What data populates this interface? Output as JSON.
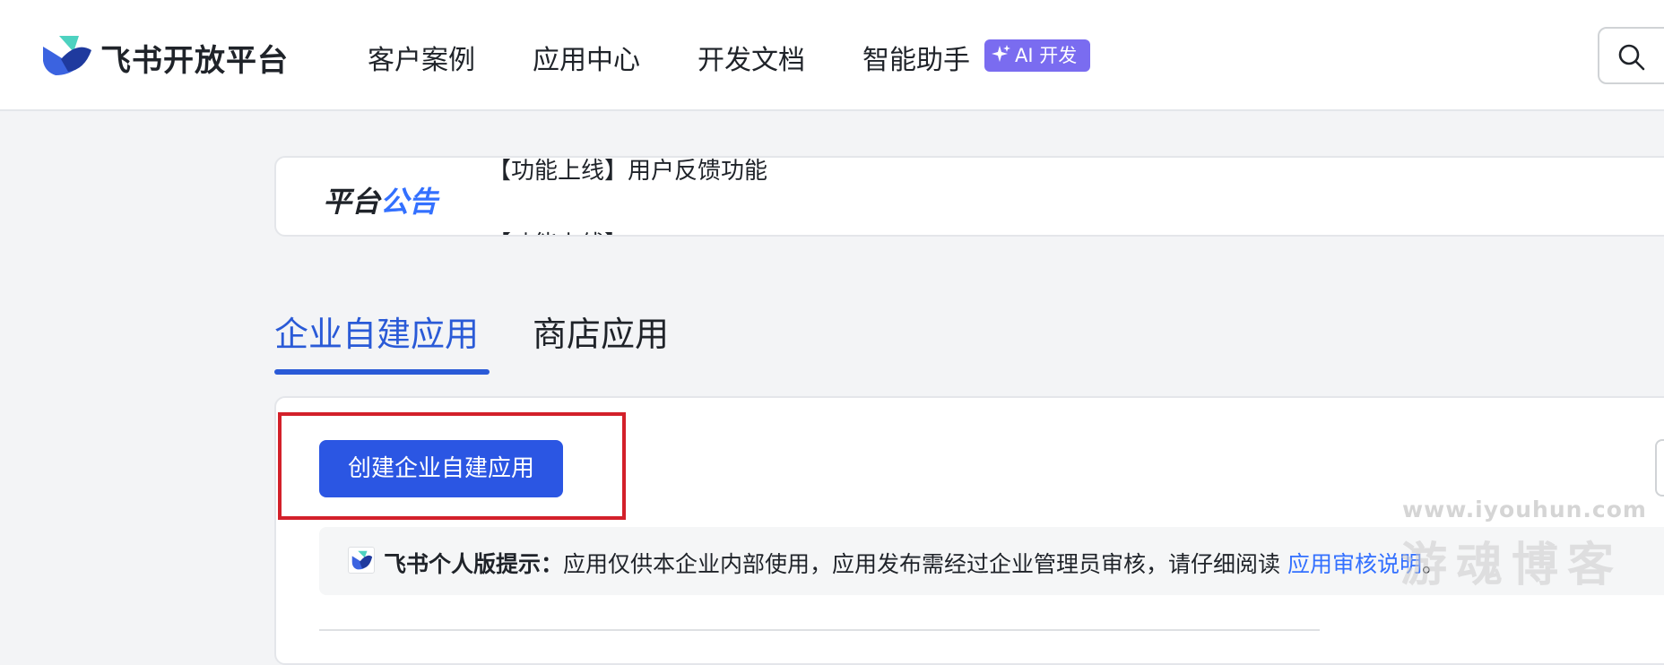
{
  "header": {
    "brand": "飞书开放平台",
    "nav": [
      "客户案例",
      "应用中心",
      "开发文档",
      "智能助手"
    ],
    "ai_badge": "AI 开发",
    "logo_icon": "feishu-logo",
    "search_icon": "search-icon"
  },
  "announcement": {
    "title_part1": "平台",
    "title_part2": "公告",
    "line1": "【功能上线】用户反馈功能",
    "line2": "【功能上线】...",
    "title_accent_color": "#3370ff"
  },
  "tabs": [
    {
      "label": "企业自建应用",
      "active": true
    },
    {
      "label": "商店应用",
      "active": false
    }
  ],
  "create_button": {
    "label": "创建企业自建应用",
    "color": "#2b56e3"
  },
  "tip": {
    "title": "飞书个人版提示：",
    "text": "应用仅供本企业内部使用，应用发布需经过企业管理员审核，请仔细阅读 ",
    "link": "应用审核说明",
    "end": "。"
  },
  "watermark": {
    "url": "www.iyouhun.com",
    "name": "游魂博客"
  },
  "colors": {
    "accent": "#2a5ad7",
    "highlight_border": "#d3202a",
    "ai_badge_bg": "#7a6cf0"
  }
}
